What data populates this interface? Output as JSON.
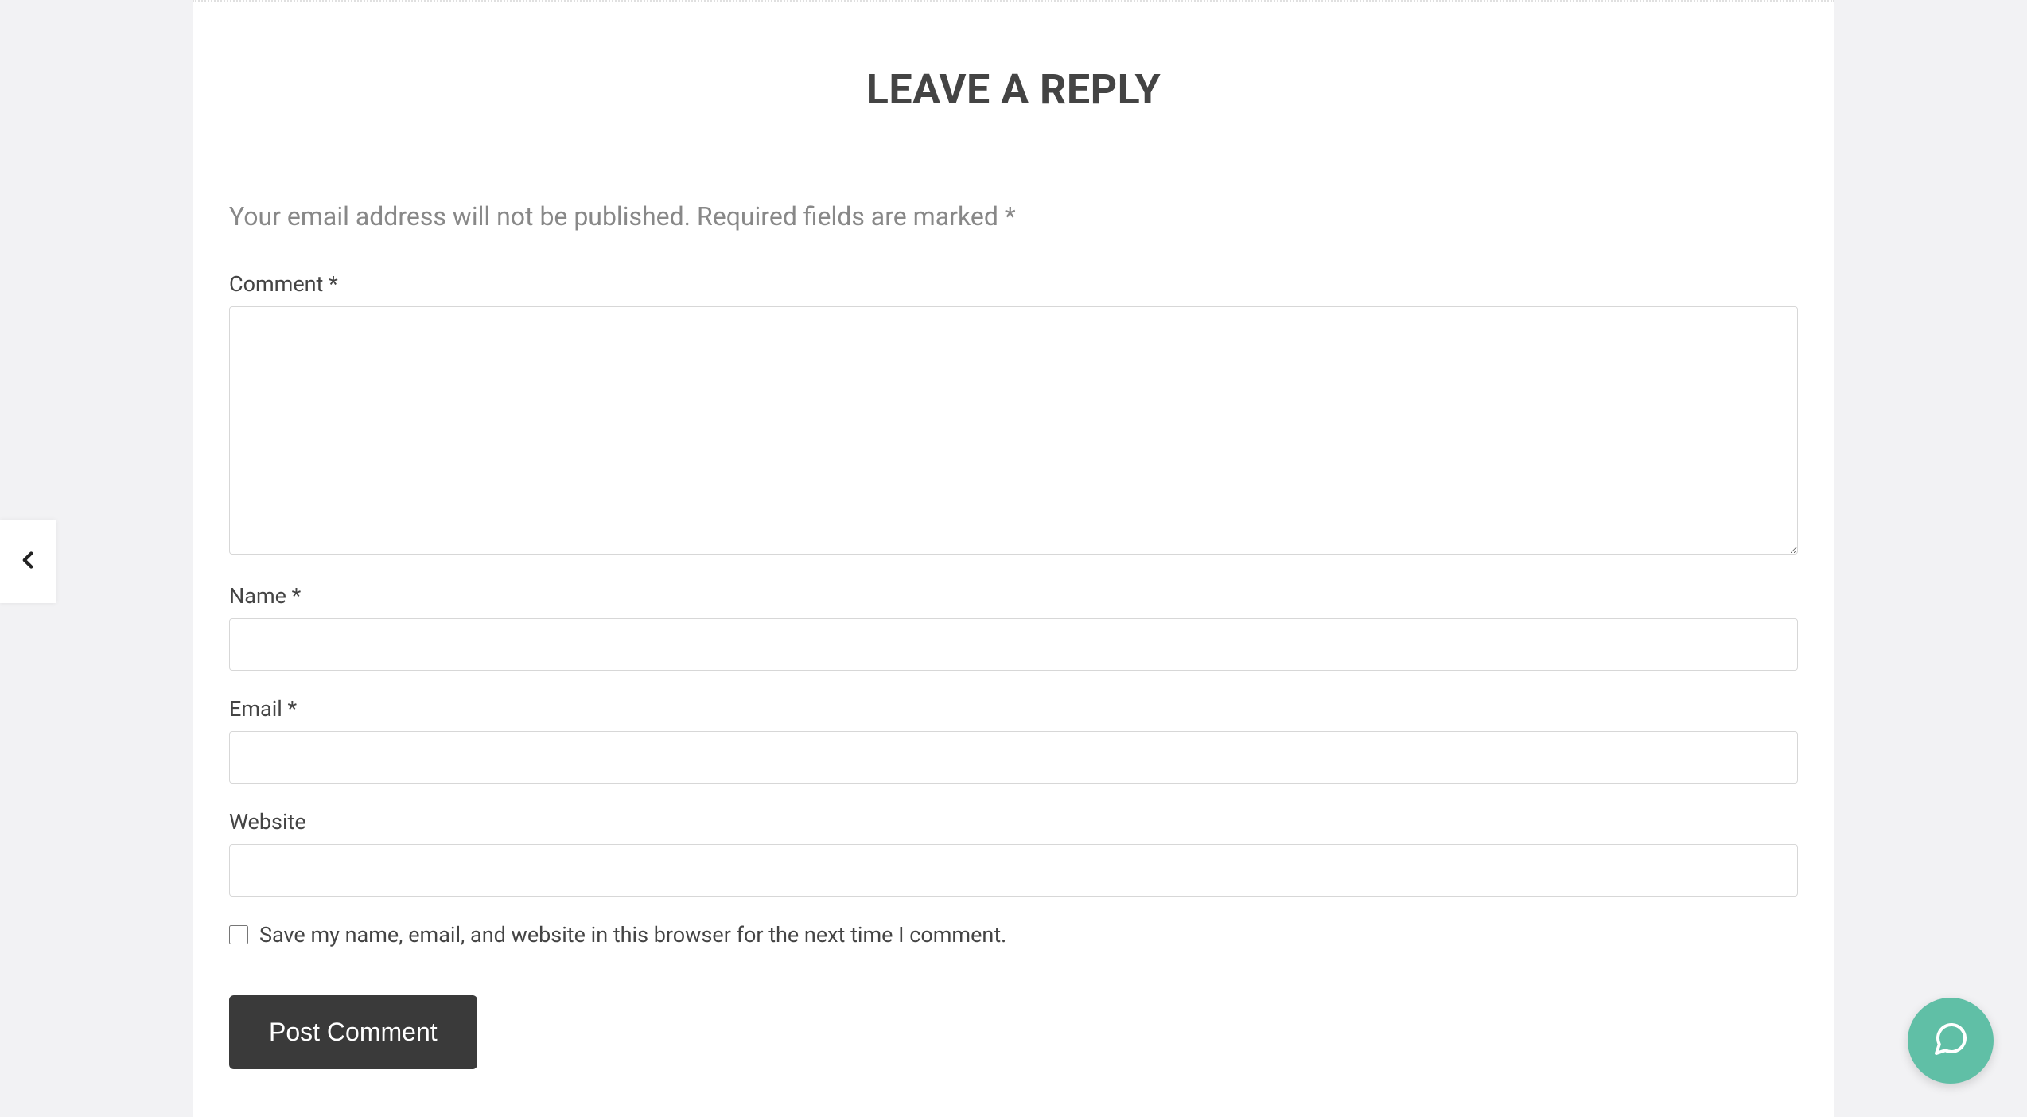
{
  "form": {
    "title": "LEAVE A REPLY",
    "intro": "Your email address will not be published. Required fields are marked *",
    "comment_label": "Comment *",
    "name_label": "Name *",
    "email_label": "Email *",
    "website_label": "Website",
    "save_label": "Save my name, email, and website in this browser for the next time I comment.",
    "submit_label": "Post Comment"
  },
  "colors": {
    "page_bg": "#f2f2f4",
    "card_bg": "#ffffff",
    "text_muted": "#888888",
    "text": "#444444",
    "border": "#d7d7d7",
    "button_bg": "#3a3a3a",
    "fab_bg": "#60bfa6"
  },
  "icons": {
    "nav_prev": "chevron-left-icon",
    "chat": "chat-icon"
  }
}
